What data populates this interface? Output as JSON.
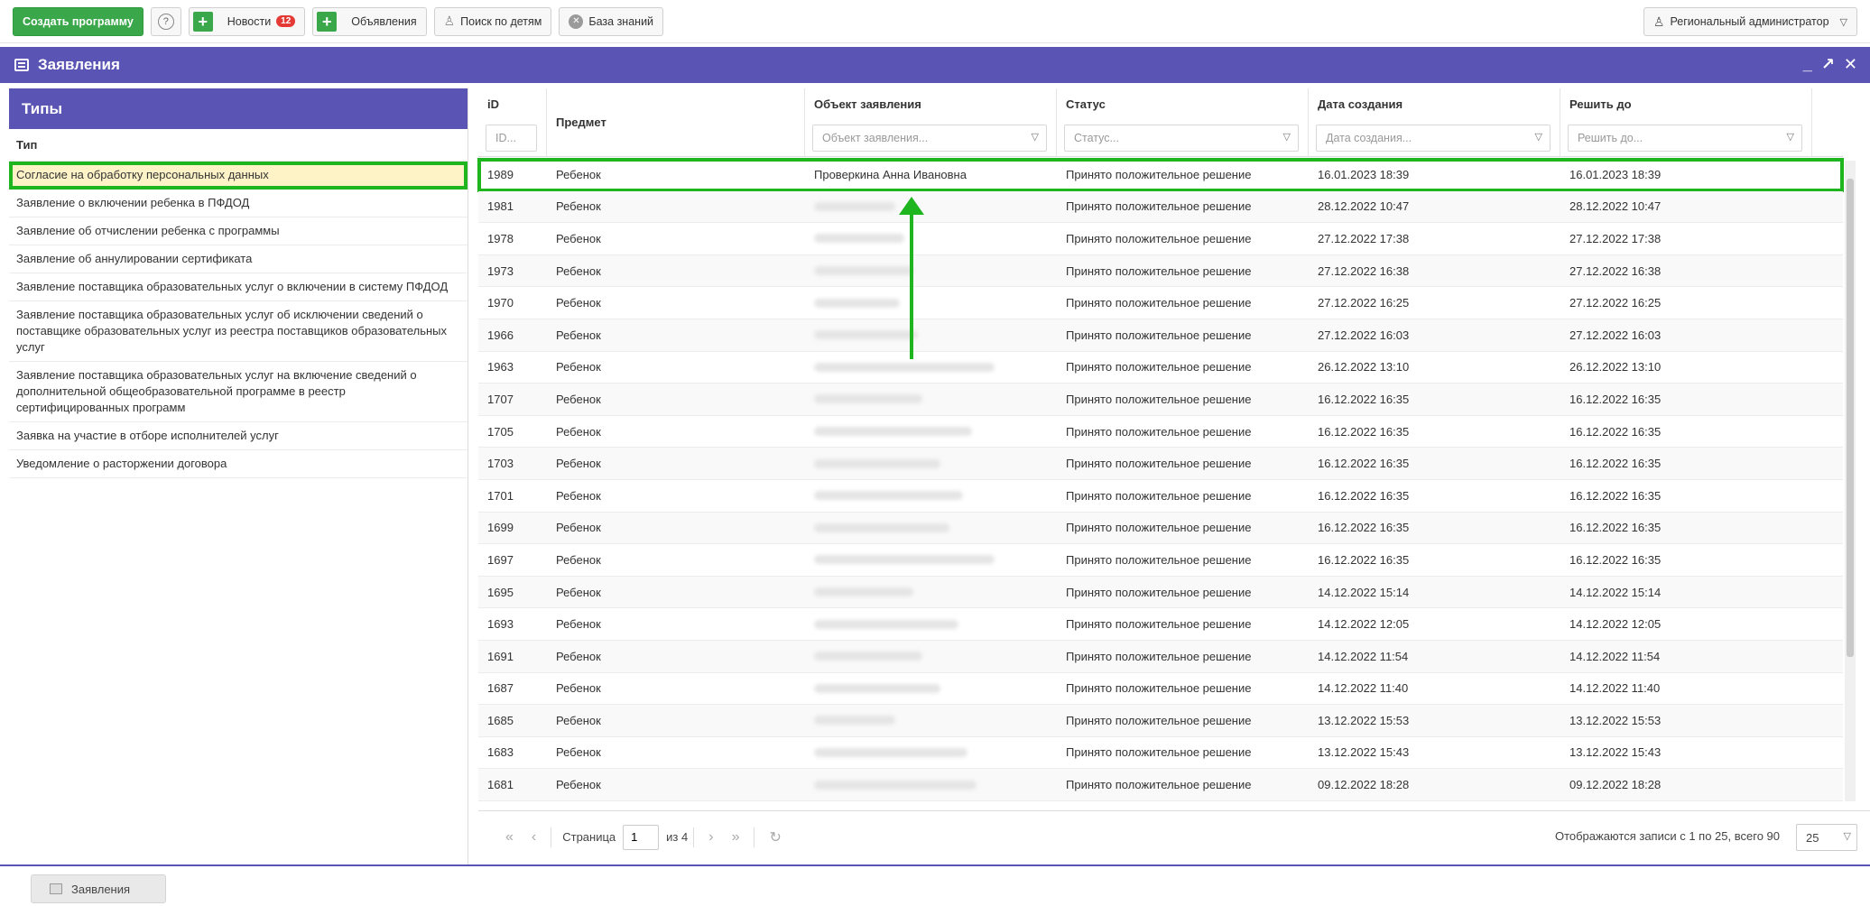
{
  "toolbar": {
    "create_program": "Создать программу",
    "help": "?",
    "news_label": "Новости",
    "news_count": "12",
    "announcements_label": "Объявления",
    "child_search_label": "Поиск по детям",
    "knowledge_base_label": "База знаний",
    "user_role": "Региональный администратор"
  },
  "window": {
    "title": "Заявления",
    "minimize": "_",
    "restore": "↗",
    "close": "✕"
  },
  "types_panel": {
    "title": "Типы",
    "column": "Тип",
    "items": [
      "Согласие на обработку персональных данных",
      "Заявление о включении ребенка в ПФДОД",
      "Заявление об отчислении ребенка с программы",
      "Заявление об аннулировании сертификата",
      "Заявление поставщика образовательных услуг о включении в систему ПФДОД",
      "Заявление поставщика образовательных услуг об исключении сведений о поставщике образовательных услуг из реестра поставщиков образовательных услуг",
      "Заявление поставщика образовательных услуг на включение сведений о дополнительной общеобразовательной программе в реестр сертифицированных программ",
      "Заявка на участие в отборе исполнителей услуг",
      "Уведомление о расторжении договора"
    ],
    "selected_index": 0
  },
  "grid": {
    "columns": {
      "id": "iD",
      "subject": "Предмет",
      "object": "Объект заявления",
      "status": "Статус",
      "created": "Дата создания",
      "deadline": "Решить до"
    },
    "filters": {
      "id": "ID...",
      "object": "Объект заявления...",
      "status": "Статус...",
      "created": "Дата создания...",
      "deadline": "Решить до..."
    },
    "rows": [
      {
        "id": "1989",
        "subject": "Ребенок",
        "object": "Проверкина Анна Ивановна",
        "status": "Принято положительное решение",
        "created": "16.01.2023 18:39",
        "deadline": "16.01.2023 18:39"
      },
      {
        "id": "1981",
        "subject": "Ребенок",
        "object": "",
        "status": "Принято положительное решение",
        "created": "28.12.2022 10:47",
        "deadline": "28.12.2022 10:47"
      },
      {
        "id": "1978",
        "subject": "Ребенок",
        "object": "",
        "status": "Принято положительное решение",
        "created": "27.12.2022 17:38",
        "deadline": "27.12.2022 17:38"
      },
      {
        "id": "1973",
        "subject": "Ребенок",
        "object": "",
        "status": "Принято положительное решение",
        "created": "27.12.2022 16:38",
        "deadline": "27.12.2022 16:38"
      },
      {
        "id": "1970",
        "subject": "Ребенок",
        "object": "",
        "status": "Принято положительное решение",
        "created": "27.12.2022 16:25",
        "deadline": "27.12.2022 16:25"
      },
      {
        "id": "1966",
        "subject": "Ребенок",
        "object": "",
        "status": "Принято положительное решение",
        "created": "27.12.2022 16:03",
        "deadline": "27.12.2022 16:03"
      },
      {
        "id": "1963",
        "subject": "Ребенок",
        "object": "",
        "status": "Принято положительное решение",
        "created": "26.12.2022 13:10",
        "deadline": "26.12.2022 13:10"
      },
      {
        "id": "1707",
        "subject": "Ребенок",
        "object": "",
        "status": "Принято положительное решение",
        "created": "16.12.2022 16:35",
        "deadline": "16.12.2022 16:35"
      },
      {
        "id": "1705",
        "subject": "Ребенок",
        "object": "",
        "status": "Принято положительное решение",
        "created": "16.12.2022 16:35",
        "deadline": "16.12.2022 16:35"
      },
      {
        "id": "1703",
        "subject": "Ребенок",
        "object": "",
        "status": "Принято положительное решение",
        "created": "16.12.2022 16:35",
        "deadline": "16.12.2022 16:35"
      },
      {
        "id": "1701",
        "subject": "Ребенок",
        "object": "",
        "status": "Принято положительное решение",
        "created": "16.12.2022 16:35",
        "deadline": "16.12.2022 16:35"
      },
      {
        "id": "1699",
        "subject": "Ребенок",
        "object": "",
        "status": "Принято положительное решение",
        "created": "16.12.2022 16:35",
        "deadline": "16.12.2022 16:35"
      },
      {
        "id": "1697",
        "subject": "Ребенок",
        "object": "",
        "status": "Принято положительное решение",
        "created": "16.12.2022 16:35",
        "deadline": "16.12.2022 16:35"
      },
      {
        "id": "1695",
        "subject": "Ребенок",
        "object": "",
        "status": "Принято положительное решение",
        "created": "14.12.2022 15:14",
        "deadline": "14.12.2022 15:14"
      },
      {
        "id": "1693",
        "subject": "Ребенок",
        "object": "",
        "status": "Принято положительное решение",
        "created": "14.12.2022 12:05",
        "deadline": "14.12.2022 12:05"
      },
      {
        "id": "1691",
        "subject": "Ребенок",
        "object": "",
        "status": "Принято положительное решение",
        "created": "14.12.2022 11:54",
        "deadline": "14.12.2022 11:54"
      },
      {
        "id": "1687",
        "subject": "Ребенок",
        "object": "",
        "status": "Принято положительное решение",
        "created": "14.12.2022 11:40",
        "deadline": "14.12.2022 11:40"
      },
      {
        "id": "1685",
        "subject": "Ребенок",
        "object": "",
        "status": "Принято положительное решение",
        "created": "13.12.2022 15:53",
        "deadline": "13.12.2022 15:53"
      },
      {
        "id": "1683",
        "subject": "Ребенок",
        "object": "",
        "status": "Принято положительное решение",
        "created": "13.12.2022 15:43",
        "deadline": "13.12.2022 15:43"
      },
      {
        "id": "1681",
        "subject": "Ребенок",
        "object": "",
        "status": "Принято положительное решение",
        "created": "09.12.2022 18:28",
        "deadline": "09.12.2022 18:28"
      }
    ],
    "highlighted_row": 0
  },
  "pager": {
    "page_label": "Страница",
    "page_value": "1",
    "of_label": "из 4",
    "info": "Отображаются записи с 1 по 25, всего 90",
    "page_size": "25"
  },
  "taskbar": {
    "item_label": "Заявления"
  },
  "colors": {
    "accent": "#5a55b4",
    "primary_green": "#3aa84a",
    "highlight_outline": "#1fb51f",
    "selected_bg": "#fdf3c7",
    "badge_red": "#e53935"
  }
}
